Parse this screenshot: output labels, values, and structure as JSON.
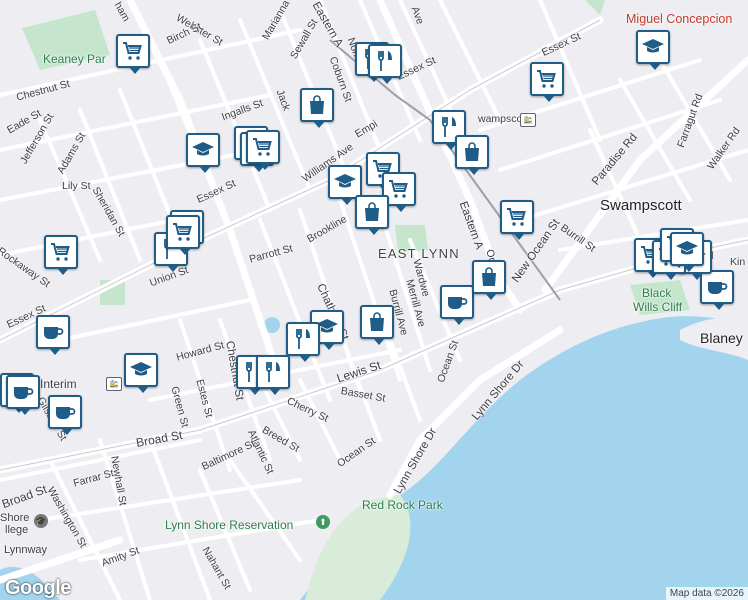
{
  "map": {
    "colors": {
      "land": "#eeeef2",
      "water": "#a3d4ee",
      "park": "#c5e6cd",
      "road": "#ffffff",
      "major_road": "#fdfdfd",
      "pin_border": "#1f5c87"
    },
    "area_labels": {
      "east_lynn": "EAST LYNN",
      "swampscott": "Swampscott",
      "miguel": "Miguel Concepcion",
      "red_rock": "Red Rock Park",
      "lynn_shore_reservation": "Lynn Shore Reservation",
      "black_wills_cliff_1": "Black",
      "black_wills_cliff_2": "Wills Cliff",
      "blaney": "Blaney",
      "keaney_park": "Keaney Par",
      "swampscott_station": "wampscott",
      "lynn_interim": "n Interim",
      "shore_college_1": "Shore",
      "shore_college_2": "llege",
      "lynnway": "Lynnway"
    },
    "streets": {
      "chestnut": "Chestnut St",
      "eade": "Eade St",
      "jefferson": "Jefferson St",
      "adams": "Adams St",
      "lily": "Lily St",
      "sheridan": "Sheridan St",
      "rockaway": "Rockaway St",
      "essex_w": "Essex St",
      "essex_mid": "Essex St",
      "essex_ne": "Essex St",
      "essex_e": "Essex St",
      "union": "Union St",
      "parrott": "Parrott St",
      "howard": "Howard St",
      "lewis": "Lewis St",
      "broad": "Broad St",
      "broad_w": "Broad St",
      "ingalls": "Ingalls St",
      "williams": "Williams Ave",
      "brookline": "Brookline",
      "webster": "Webster St",
      "birch": "Birch St",
      "marianna": "Marianna St",
      "sewall": "Sewall St",
      "coburn": "Coburn St",
      "eastern_n": "Eastern A",
      "eastern_s": "Eastern A",
      "paradise": "Paradise Rd",
      "farragut": "Farragut Rd",
      "walker": "Walker Rd",
      "burrill": "Burrill St",
      "new_ocean": "New Ocean St",
      "ocean": "Ocean St",
      "ocean_w": "Ocean St",
      "lynn_shore_1": "Lynn Shore Dr",
      "lynn_shore_2": "Lynn Shore Dr",
      "chatham": "Chatham St",
      "merrill": "Merrill Ave",
      "burrill_ave": "Burrill Ave",
      "basset": "Basset St",
      "cherry": "Cherry St",
      "breed": "Breed St",
      "atlantic": "Atlantic St",
      "baltimore": "Baltimore St",
      "green": "Green St",
      "estes": "Estes St",
      "farrar": "Farrar St",
      "newhall": "Newhall St",
      "washington": "Washington St",
      "amity": "Amity St",
      "nahant": "Nahant St",
      "gilsbee": "Gilsbee St",
      "chestnut_s": "Chestnut St",
      "empire": "Empi",
      "wardwell": "Wardwe",
      "jack": "Jack",
      "norm": "Norm",
      "oct": "Or",
      "ham": "ham",
      "kin": "Kin",
      "rd": "Rd",
      "ave_ne": "Ave",
      "essex_n": "Essex St"
    },
    "attribution": "Map data ©2026",
    "logo": "Google"
  },
  "pins": [
    {
      "icon": "cart",
      "label": "shopping"
    },
    {
      "icon": "cart",
      "label": "shopping"
    },
    {
      "icon": "bag",
      "label": "shopping-bag"
    },
    {
      "icon": "fork",
      "label": "restaurant"
    },
    {
      "icon": "fork",
      "label": "restaurant"
    },
    {
      "icon": "cart",
      "label": "shopping"
    },
    {
      "icon": "cap",
      "label": "school"
    },
    {
      "icon": "fork",
      "label": "restaurant"
    },
    {
      "icon": "bag",
      "label": "shopping-bag"
    },
    {
      "icon": "cap",
      "label": "school"
    },
    {
      "icon": "cart",
      "label": "shopping"
    },
    {
      "icon": "cart",
      "label": "shopping"
    },
    {
      "icon": "cart",
      "label": "shopping"
    },
    {
      "icon": "cap",
      "label": "school"
    },
    {
      "icon": "cart",
      "label": "shopping"
    },
    {
      "icon": "bag",
      "label": "shopping-bag"
    },
    {
      "icon": "cart",
      "label": "shopping"
    },
    {
      "icon": "cart",
      "label": "shopping"
    },
    {
      "icon": "fork",
      "label": "restaurant"
    },
    {
      "icon": "cart",
      "label": "shopping"
    },
    {
      "icon": "cup",
      "label": "cafe"
    },
    {
      "icon": "cap",
      "label": "school"
    },
    {
      "icon": "cup",
      "label": "cafe"
    },
    {
      "icon": "cup",
      "label": "cafe"
    },
    {
      "icon": "bag",
      "label": "shopping-bag"
    },
    {
      "icon": "cap",
      "label": "school"
    },
    {
      "icon": "fork",
      "label": "restaurant"
    },
    {
      "icon": "bag",
      "label": "shopping-bag"
    },
    {
      "icon": "fork",
      "label": "restaurant"
    },
    {
      "icon": "fork",
      "label": "restaurant"
    },
    {
      "icon": "cap",
      "label": "school"
    },
    {
      "icon": "cup",
      "label": "cafe"
    },
    {
      "icon": "cup",
      "label": "cafe"
    },
    {
      "icon": "cart",
      "label": "shopping"
    },
    {
      "icon": "cart",
      "label": "shopping"
    },
    {
      "icon": "cap",
      "label": "school"
    },
    {
      "icon": "cart",
      "label": "shopping"
    },
    {
      "icon": "cup",
      "label": "cafe"
    },
    {
      "icon": "cart",
      "label": "shopping"
    }
  ]
}
